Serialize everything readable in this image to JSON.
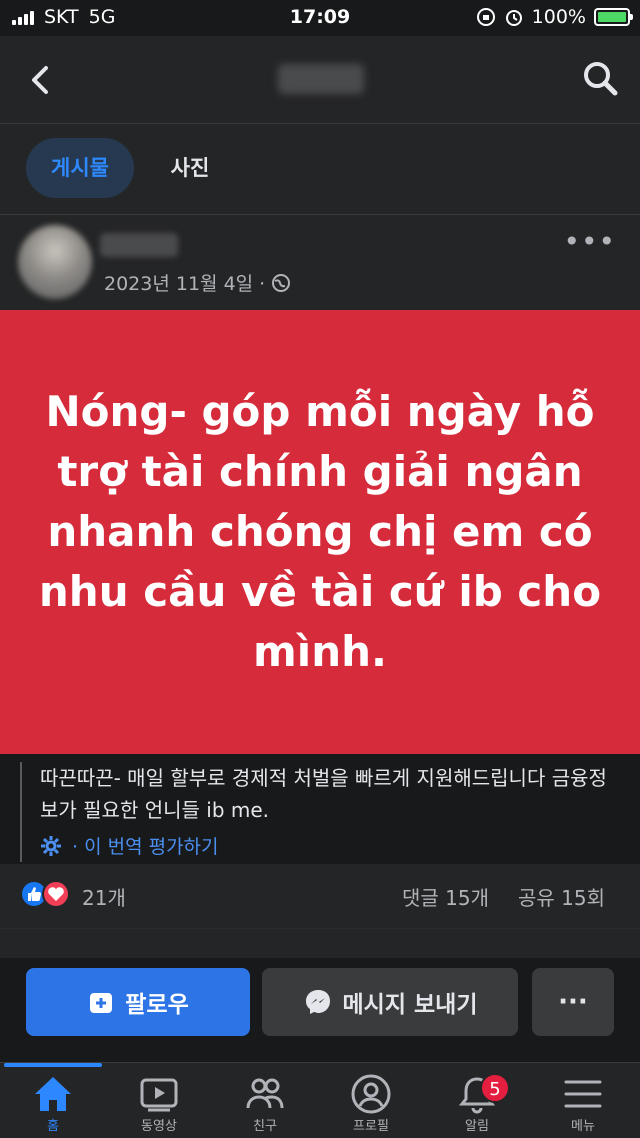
{
  "status_bar": {
    "carrier": "SKT",
    "network": "5G",
    "time": "17:09",
    "battery": "100%"
  },
  "tabs": [
    {
      "label": "게시물",
      "active": true
    },
    {
      "label": "사진",
      "active": false
    }
  ],
  "post": {
    "date": "2023년 11월 4일 ·",
    "banner_text": "Nóng- góp mỗi ngày hỗ trợ tài chính giải ngân nhanh chóng chị em có nhu cầu về tài cứ ib cho mình.",
    "banner_color": "#d62b3b",
    "caption": "따끈따끈- 매일 할부로 경제적 처벌을 빠르게 지원해드립니다 금융정보가 필요한 언니들 ib me.",
    "translate_label": "· 이 번역 평가하기",
    "reaction_count": "21개",
    "comments": "댓글 15개",
    "shares": "공유 15회"
  },
  "actions": {
    "follow": "팔로우",
    "message": "메시지 보내기",
    "more": "···"
  },
  "tabbar": [
    {
      "label": "홈",
      "icon": "home-icon",
      "active": true
    },
    {
      "label": "동영상",
      "icon": "video-icon",
      "active": false
    },
    {
      "label": "친구",
      "icon": "friends-icon",
      "active": false
    },
    {
      "label": "프로필",
      "icon": "profile-icon",
      "active": false
    },
    {
      "label": "알림",
      "icon": "bell-icon",
      "active": false,
      "badge": "5"
    },
    {
      "label": "메뉴",
      "icon": "menu-icon",
      "active": false
    }
  ],
  "colors": {
    "accent": "#2d88ff",
    "background": "#242526",
    "badge": "#e41e3f"
  }
}
